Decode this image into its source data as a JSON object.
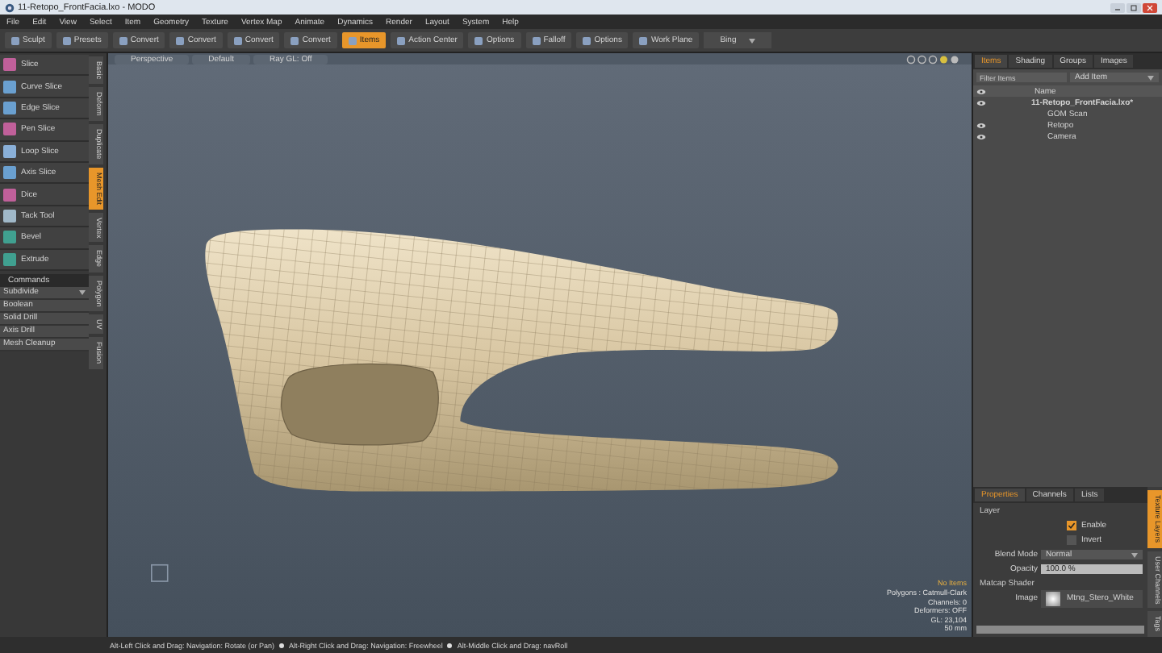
{
  "window": {
    "title": "11-Retopo_FrontFacia.lxo - MODO"
  },
  "menu": [
    "File",
    "Edit",
    "View",
    "Select",
    "Item",
    "Geometry",
    "Texture",
    "Vertex Map",
    "Animate",
    "Dynamics",
    "Render",
    "Layout",
    "System",
    "Help"
  ],
  "toolbar": [
    {
      "label": "Sculpt",
      "kind": "button",
      "selected": false
    },
    {
      "label": "Presets",
      "kind": "button",
      "selected": false
    },
    {
      "label": "Convert",
      "kind": "button",
      "selected": false
    },
    {
      "label": "Convert",
      "kind": "button",
      "selected": false
    },
    {
      "label": "Convert",
      "kind": "button",
      "selected": false
    },
    {
      "label": "Convert",
      "kind": "button",
      "selected": false
    },
    {
      "label": "Items",
      "kind": "button",
      "selected": true
    },
    {
      "label": "Action Center",
      "kind": "button",
      "selected": false
    },
    {
      "label": "Options",
      "kind": "button",
      "selected": false
    },
    {
      "label": "Falloff",
      "kind": "button",
      "selected": false
    },
    {
      "label": "Options",
      "kind": "button",
      "selected": false
    },
    {
      "label": "Work Plane",
      "kind": "button",
      "selected": false
    },
    {
      "label": "Bing",
      "kind": "dropdown"
    }
  ],
  "left_panel": {
    "tools": [
      "Slice",
      "Curve Slice",
      "Edge Slice",
      "Pen Slice",
      "Loop Slice",
      "Axis Slice",
      "Dice",
      "Tack Tool",
      "Bevel",
      "Extrude"
    ],
    "commands_title": "Commands",
    "commands": [
      {
        "label": "Subdivide",
        "kind": "dropdown"
      },
      {
        "label": "Boolean",
        "kind": "item"
      },
      {
        "label": "Solid Drill",
        "kind": "item"
      },
      {
        "label": "Axis Drill",
        "kind": "item"
      },
      {
        "label": "Mesh Cleanup",
        "kind": "item"
      }
    ],
    "tabs": [
      {
        "label": "Basic",
        "selected": false
      },
      {
        "label": "Deform",
        "selected": false
      },
      {
        "label": "Duplicate",
        "selected": false
      },
      {
        "label": "Mesh Edit",
        "selected": true
      },
      {
        "label": "Vertex",
        "selected": false
      },
      {
        "label": "Edge",
        "selected": false
      },
      {
        "label": "Polygon",
        "selected": false
      },
      {
        "label": "UV",
        "selected": false
      },
      {
        "label": "Fusion",
        "selected": false
      }
    ]
  },
  "viewport": {
    "tabs": [
      "Perspective",
      "Default",
      "Ray GL: Off"
    ],
    "hud": [
      {
        "text": "No Items",
        "kind": "warning"
      },
      {
        "text": "Polygons : Catmull-Clark",
        "kind": "info"
      },
      {
        "text": "Channels: 0",
        "kind": "info"
      },
      {
        "text": "Deformers: OFF",
        "kind": "info"
      },
      {
        "text": "GL: 23,104",
        "kind": "info"
      },
      {
        "text": "50 mm",
        "kind": "info"
      }
    ]
  },
  "items_panel": {
    "tabs": [
      {
        "label": "Items",
        "selected": true
      },
      {
        "label": "Shading",
        "selected": false
      },
      {
        "label": "Groups",
        "selected": false
      },
      {
        "label": "Images",
        "selected": false
      }
    ],
    "filter_placeholder": "Filter Items",
    "add_item": "Add Item",
    "column": "Name",
    "tree": [
      {
        "name": "11-Retopo_FrontFacia.lxo*",
        "visible": true,
        "children": [
          {
            "name": "GOM Scan",
            "visible": false
          },
          {
            "name": "Retopo",
            "visible": true
          },
          {
            "name": "Camera",
            "visible": true
          }
        ]
      }
    ]
  },
  "properties_panel": {
    "tabs": [
      {
        "label": "Properties",
        "selected": true
      },
      {
        "label": "Channels",
        "selected": false
      },
      {
        "label": "Lists",
        "selected": false
      }
    ],
    "side_tabs": [
      {
        "label": "Texture Layers",
        "selected": true
      },
      {
        "label": "User Channels",
        "selected": false
      },
      {
        "label": "Tags",
        "selected": false
      }
    ],
    "layer_title": "Layer",
    "enable": {
      "label": "Enable",
      "checked": true
    },
    "invert": {
      "label": "Invert",
      "checked": false
    },
    "blend_mode_label": "Blend Mode",
    "blend_mode": "Normal",
    "opacity_label": "Opacity",
    "opacity": "100.0 %",
    "matcap_title": "Matcap Shader",
    "image_label": "Image",
    "image": "Mtng_Stero_White"
  },
  "status_bar": [
    "Alt-Left Click and Drag: Navigation: Rotate (or Pan)",
    "Alt-Right Click and Drag: Navigation: Freewheel",
    "Alt-Middle Click and Drag: navRoll"
  ]
}
